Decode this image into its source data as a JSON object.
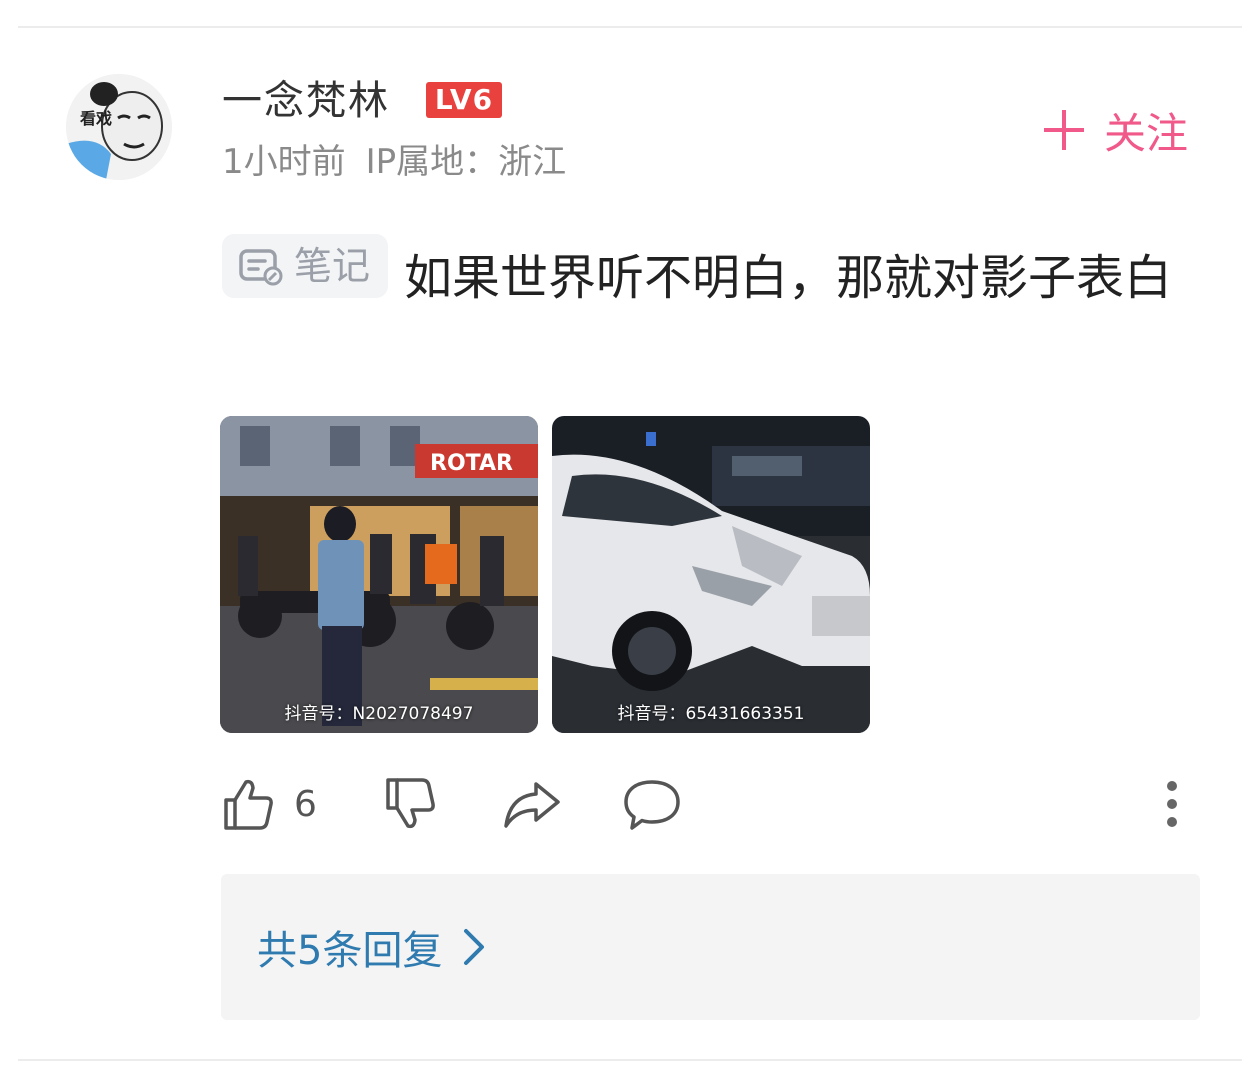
{
  "comment": {
    "username": "一念梵林",
    "level_badge": "LV6",
    "time": "1小时前",
    "ip_location": "IP属地：浙江",
    "follow_label": "关注",
    "note_tag_label": "笔记",
    "text": "如果世界听不明白，那就对影子表白",
    "avatar_caption": "看戏",
    "images": [
      {
        "sign_text": "ROTAR",
        "watermark": "抖音号：N2027078497"
      },
      {
        "watermark": "抖音号：65431663351"
      }
    ],
    "like_count": "6",
    "replies_label": "共5条回复"
  },
  "colors": {
    "follow_accent": "#f0598a",
    "level_badge": "#e8413e",
    "replies_link": "#2f7bb0",
    "meta_text": "#8a8a8a"
  },
  "icons": {
    "like": "thumb-up-icon",
    "dislike": "thumb-down-icon",
    "share": "share-arrow-icon",
    "reply": "speech-bubble-icon",
    "more": "more-vertical-icon",
    "replies_arrow": "chevron-right-icon",
    "note": "note-icon",
    "follow": "plus-icon"
  }
}
